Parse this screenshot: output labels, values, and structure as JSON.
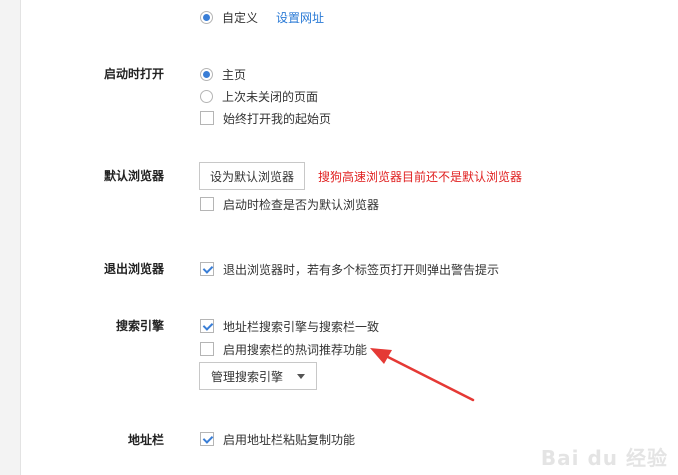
{
  "homepage": {
    "custom_label": "自定义",
    "set_url_link": "设置网址"
  },
  "startup": {
    "title": "启动时打开",
    "options": [
      "主页",
      "上次未关闭的页面"
    ],
    "always_open_start": "始终打开我的起始页"
  },
  "default_browser": {
    "title": "默认浏览器",
    "button_label": "设为默认浏览器",
    "warning": "搜狗高速浏览器目前还不是默认浏览器",
    "check_on_startup": "启动时检查是否为默认浏览器"
  },
  "exit_browser": {
    "title": "退出浏览器",
    "warn_multiple_tabs": "退出浏览器时，若有多个标签页打开则弹出警告提示"
  },
  "search_engine": {
    "title": "搜索引擎",
    "sync_with_address_bar": "地址栏搜索引擎与搜索栏一致",
    "hot_recommend": "启用搜索栏的热词推荐功能",
    "manage_button": "管理搜索引擎"
  },
  "address_bar": {
    "title": "地址栏",
    "paste_copy": "启用地址栏粘贴复制功能"
  },
  "watermark_text": "Bai du 经验",
  "colors": {
    "accent": "#3a7ed6",
    "link": "#2a7ad6",
    "warning": "#e02020",
    "annotation_arrow": "#e53935"
  }
}
